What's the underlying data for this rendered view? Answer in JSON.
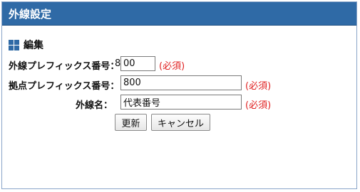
{
  "window": {
    "title": "外線設定"
  },
  "section": {
    "icon": "grid-icon",
    "title": "編集"
  },
  "form": {
    "outside_prefix": {
      "label": "外線プレフィックス番号：",
      "fixed_prefix": "8",
      "value": "00",
      "required": "(必須)"
    },
    "site_prefix": {
      "label": "拠点プレフィックス番号：",
      "value": "800",
      "required": "(必須)"
    },
    "line_name": {
      "label": "外線名：",
      "value": "代表番号",
      "required": "(必須)"
    }
  },
  "buttons": {
    "update": "更新",
    "cancel": "キャンセル"
  },
  "colors": {
    "titlebar": "#2f6aa6",
    "required": "#e02020",
    "border": "#8aa5c9"
  }
}
